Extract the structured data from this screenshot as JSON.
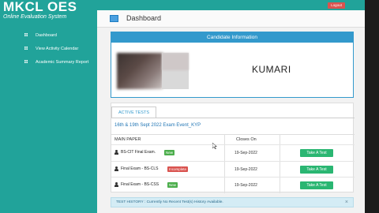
{
  "brand": {
    "title": "MKCL OES",
    "subtitle": "Online Evaluation System"
  },
  "topbar": {
    "user": "",
    "logout_label": "Logout"
  },
  "sidebar": {
    "items": [
      {
        "label": "Dashboard",
        "icon": "grid-icon"
      },
      {
        "label": "View Activity Calendar",
        "icon": "calendar-icon"
      },
      {
        "label": "Academic Summary Report",
        "icon": "report-icon"
      }
    ]
  },
  "header": {
    "title": "Dashboard",
    "icon": "monitor-icon"
  },
  "candidate": {
    "heading": "Candidate Information",
    "name": "KUMARI"
  },
  "tests": {
    "tab_label": "ACTIVE TESTS",
    "event_title": "16th & 19th Sept 2022 Exam Event_KYP",
    "columns": {
      "paper": "MAIN PAPER",
      "closes": "Closes On"
    },
    "rows": [
      {
        "paper": "BS-CIT Final Exam.",
        "badge": "New",
        "badge_type": "new",
        "closes_on": "19-Sep-2022",
        "action": "Take A Test"
      },
      {
        "paper": "Final Exam - BS-CLS",
        "badge": "Incomplete",
        "badge_type": "incomplete",
        "closes_on": "19-Sep-2022",
        "action": "Take A Test"
      },
      {
        "paper": "Final Exam - BS-CSS",
        "badge": "New",
        "badge_type": "new",
        "closes_on": "19-Sep-2022",
        "action": "Take A Test"
      }
    ]
  },
  "history": {
    "label": "TEST HISTORY :",
    "text": "Currently No Recent Test(s) History Available.",
    "close": "×"
  },
  "colors": {
    "sidebar": "#21a39a",
    "panel_header": "#3399cc",
    "button": "#2ab672",
    "badge_new": "#4cae4c",
    "badge_incomplete": "#d9534f"
  }
}
